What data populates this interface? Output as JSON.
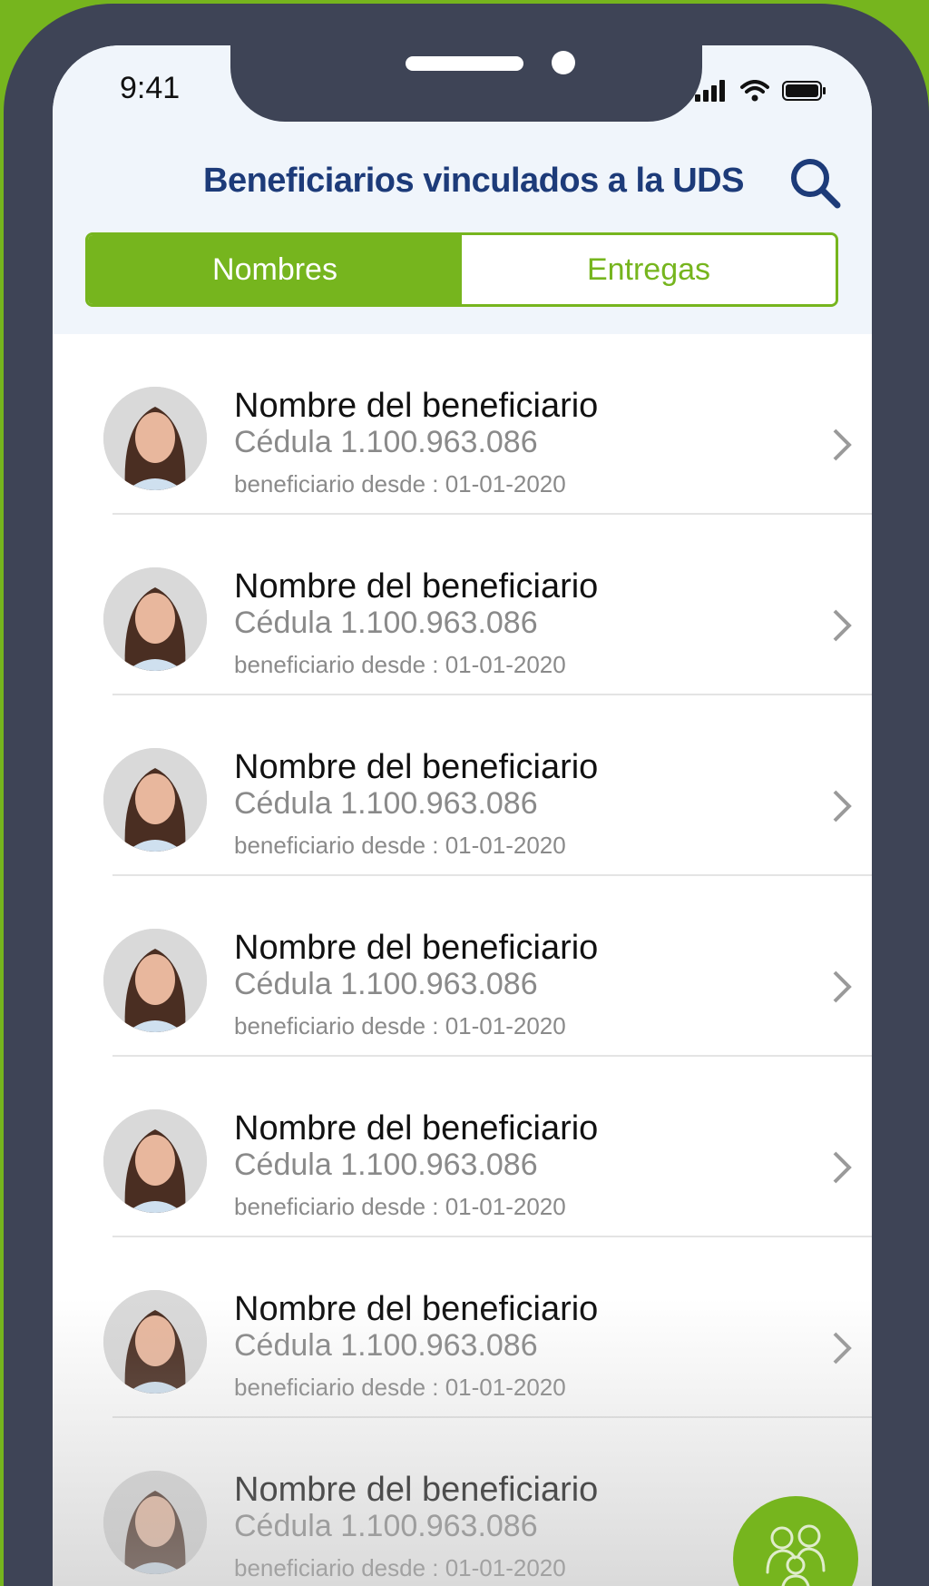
{
  "status_bar": {
    "time": "9:41"
  },
  "header": {
    "title": "Beneficiarios vinculados a la UDS"
  },
  "tabs": [
    {
      "label": "Nombres",
      "active": true
    },
    {
      "label": "Entregas",
      "active": false
    }
  ],
  "beneficiaries": [
    {
      "name": "Nombre del beneficiario",
      "id": "Cédula 1.100.963.086",
      "since": "beneficiario desde : 01-01-2020"
    },
    {
      "name": "Nombre del beneficiario",
      "id": "Cédula 1.100.963.086",
      "since": "beneficiario desde : 01-01-2020"
    },
    {
      "name": "Nombre del beneficiario",
      "id": "Cédula 1.100.963.086",
      "since": "beneficiario desde : 01-01-2020"
    },
    {
      "name": "Nombre del beneficiario",
      "id": "Cédula 1.100.963.086",
      "since": "beneficiario desde : 01-01-2020"
    },
    {
      "name": "Nombre del beneficiario",
      "id": "Cédula 1.100.963.086",
      "since": "beneficiario desde : 01-01-2020"
    },
    {
      "name": "Nombre del beneficiario",
      "id": "Cédula 1.100.963.086",
      "since": "beneficiario desde : 01-01-2020"
    },
    {
      "name": "Nombre del beneficiario",
      "id": "Cédula 1.100.963.086",
      "since": "beneficiario desde : 01-01-2020"
    }
  ],
  "fab": {
    "icon": "family-icon"
  },
  "colors": {
    "accent": "#76b51e",
    "title": "#1d3b79",
    "frame": "#3e4456"
  }
}
